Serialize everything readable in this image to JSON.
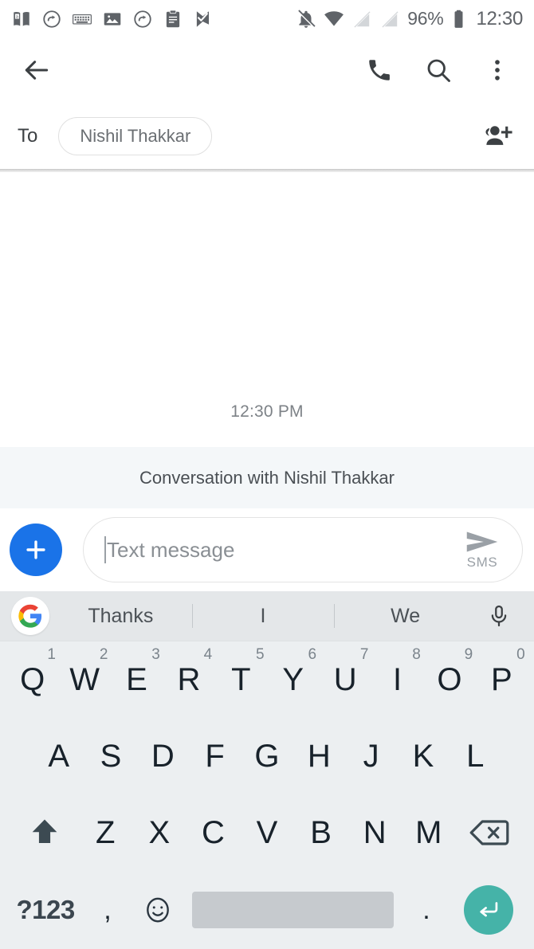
{
  "status_bar": {
    "left_icons": [
      "kindle-book-icon",
      "forward-circle-icon",
      "keyboard-icon",
      "image-icon",
      "forward-circle-icon-2",
      "clipboard-icon",
      "check-flag-icon"
    ],
    "right_icons": [
      "notifications-off-icon",
      "wifi-icon",
      "no-sim-1-icon",
      "no-sim-2-icon",
      "battery-icon"
    ],
    "battery_percent": "96%",
    "clock": "12:30"
  },
  "app_bar": {
    "back_icon": "back-arrow-icon",
    "call_icon": "phone-icon",
    "search_icon": "search-icon",
    "overflow_icon": "more-vert-icon"
  },
  "recipient_row": {
    "to_label": "To",
    "chip_name": "Nishil Thakkar",
    "add_people_icon": "add-people-icon"
  },
  "conversation": {
    "timestamp": "12:30 PM",
    "banner": "Conversation with Nishil Thakkar"
  },
  "compose": {
    "plus_label": "+",
    "placeholder": "Text message",
    "input_value": "",
    "send_icon": "send-icon",
    "send_label": "SMS"
  },
  "keyboard": {
    "google_logo": "google-g-icon",
    "mic_icon": "microphone-icon",
    "suggestions": [
      "Thanks",
      "I",
      "We"
    ],
    "row1": [
      {
        "key": "Q",
        "num": "1"
      },
      {
        "key": "W",
        "num": "2"
      },
      {
        "key": "E",
        "num": "3"
      },
      {
        "key": "R",
        "num": "4"
      },
      {
        "key": "T",
        "num": "5"
      },
      {
        "key": "Y",
        "num": "6"
      },
      {
        "key": "U",
        "num": "7"
      },
      {
        "key": "I",
        "num": "8"
      },
      {
        "key": "O",
        "num": "9"
      },
      {
        "key": "P",
        "num": "0"
      }
    ],
    "row2": [
      "A",
      "S",
      "D",
      "F",
      "G",
      "H",
      "J",
      "K",
      "L"
    ],
    "row3": [
      "Z",
      "X",
      "C",
      "V",
      "B",
      "N",
      "M"
    ],
    "shift_icon": "shift-icon",
    "backspace_icon": "backspace-icon",
    "symbols_key": "?123",
    "comma_key": ",",
    "emoji_icon": "emoji-icon",
    "space_key": "",
    "period_key": ".",
    "enter_icon": "enter-icon"
  },
  "colors": {
    "accent_blue": "#1a73e8",
    "enter_teal": "#45b3a8",
    "keyboard_bg": "#eceff1",
    "suggestion_bg": "#e4e7e9",
    "banner_bg": "#f4f7f9",
    "key_text": "#18222b"
  }
}
